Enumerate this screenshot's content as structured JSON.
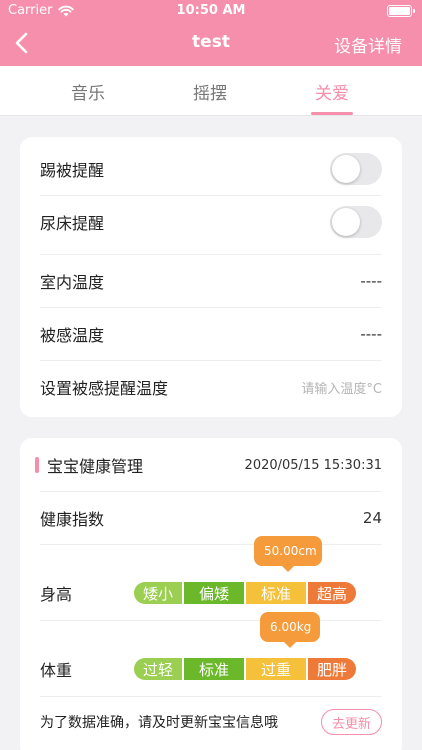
{
  "status": {
    "carrier": "Carrier",
    "time": "10:50 AM"
  },
  "nav": {
    "title": "test",
    "right_label": "设备详情"
  },
  "tabs": [
    {
      "label": "音乐"
    },
    {
      "label": "摇摆"
    },
    {
      "label": "关爱",
      "active": true
    }
  ],
  "settings": {
    "kick_reminder": {
      "label": "踢被提醒",
      "enabled": false
    },
    "bedwetting_reminder": {
      "label": "尿床提醒",
      "enabled": false
    },
    "indoor_temp": {
      "label": "室内温度",
      "value": "----"
    },
    "quilt_temp": {
      "label": "被感温度",
      "value": "----"
    },
    "quilt_alert_temp": {
      "label": "设置被感提醒温度",
      "placeholder": "请输入温度°C"
    }
  },
  "health": {
    "title": "宝宝健康管理",
    "timestamp": "2020/05/15 15:30:31",
    "index": {
      "label": "健康指数",
      "value": "24"
    },
    "height": {
      "label": "身高",
      "value": "50.00cm",
      "segments": [
        "矮小",
        "偏矮",
        "标准",
        "超高"
      ],
      "current_index": 2
    },
    "weight": {
      "label": "体重",
      "value": "6.00kg",
      "segments": [
        "过轻",
        "标准",
        "过重",
        "肥胖"
      ],
      "current_index": 2
    },
    "reminder": {
      "text": "为了数据准确，请及时更新宝宝信息哦",
      "button": "去更新"
    }
  },
  "colors": {
    "brand_pink": "#f58fab",
    "scale_light_green": "#9bcf52",
    "scale_green": "#6cb82b",
    "scale_yellow": "#f5c03a",
    "scale_orange": "#ee7a3a",
    "bubble_orange": "#f59b3b"
  }
}
